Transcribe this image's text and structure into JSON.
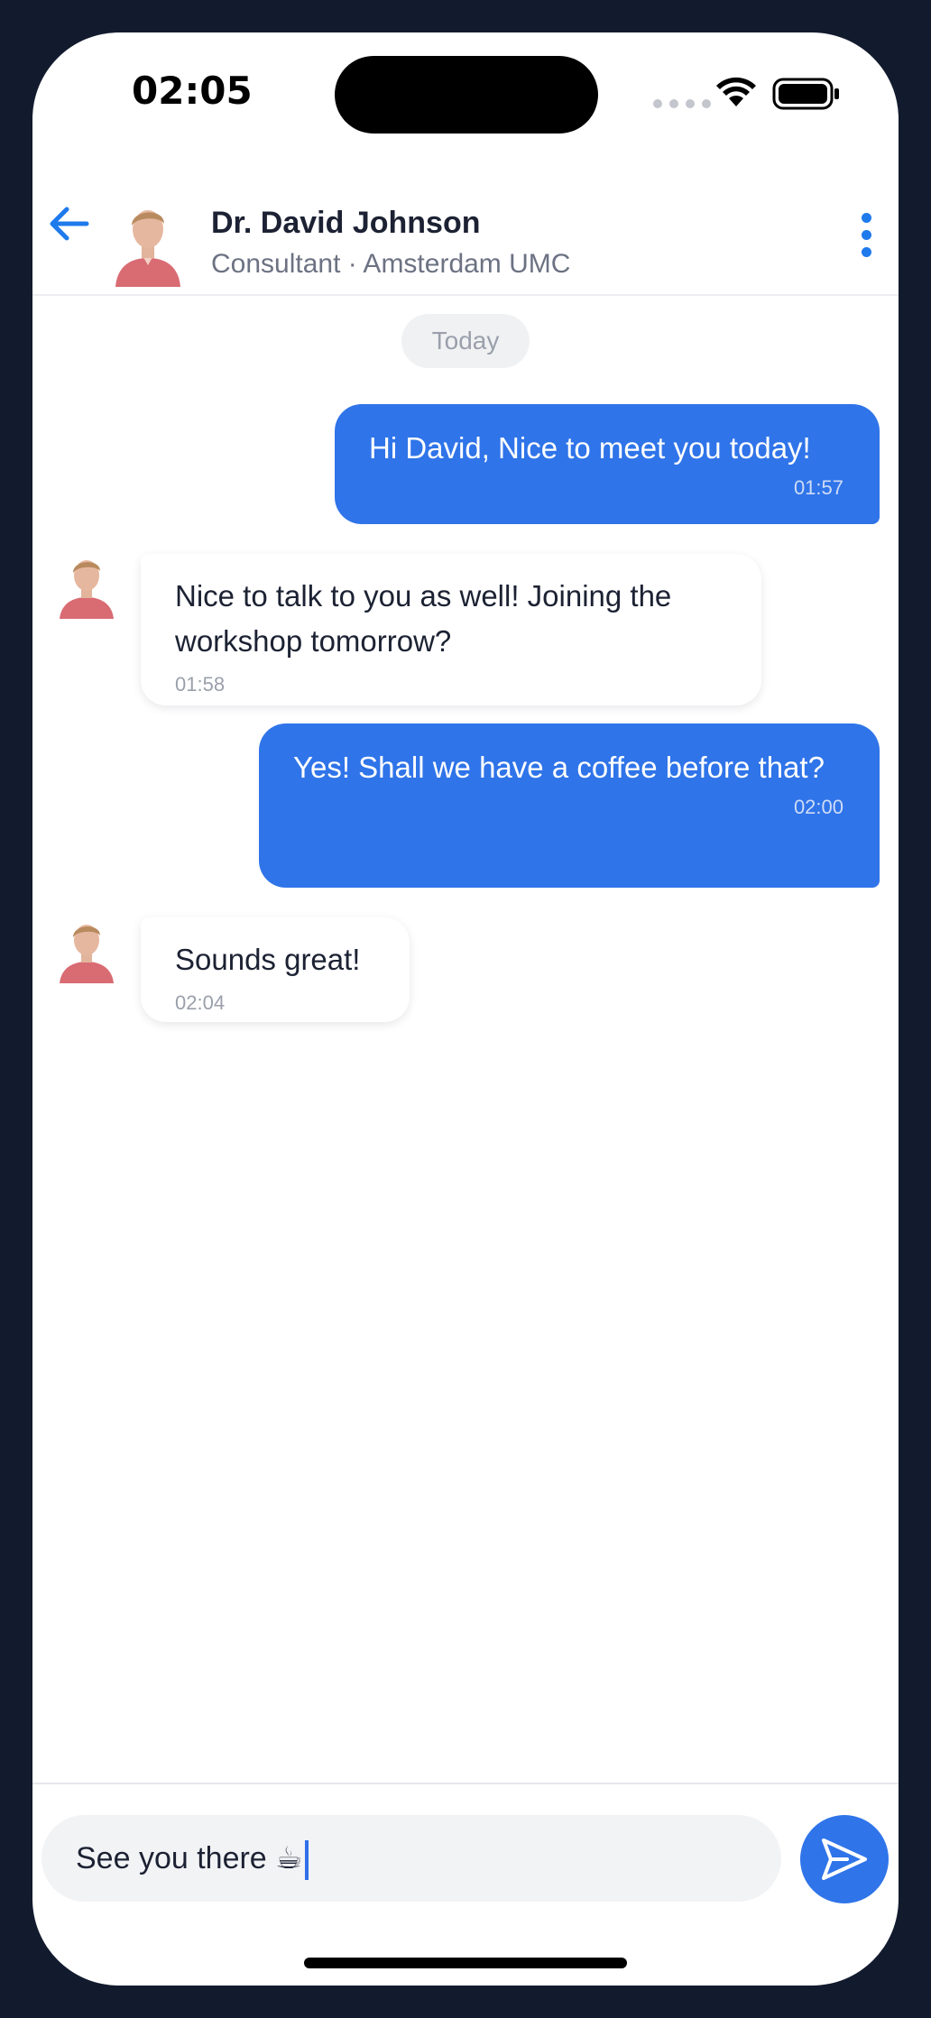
{
  "status_bar": {
    "time": "02:05"
  },
  "header": {
    "contact_name": "Dr. David Johnson",
    "contact_subtitle": "Consultant · Amsterdam UMC"
  },
  "chat": {
    "date_separator": "Today",
    "messages": [
      {
        "direction": "outgoing",
        "text": "Hi David, Nice to meet you today!",
        "time": "01:57"
      },
      {
        "direction": "incoming",
        "text": "Nice to talk to you as well! Joining the workshop tomorrow?",
        "time": "01:58"
      },
      {
        "direction": "outgoing",
        "text": "Yes! Shall we have a coffee before that?",
        "time": "02:00"
      },
      {
        "direction": "incoming",
        "text": "Sounds great!",
        "time": "02:04"
      }
    ]
  },
  "composer": {
    "value": "See you there ☕"
  },
  "colors": {
    "accent": "#2f74e9",
    "frame": "#121a2e",
    "bubble_in": "#ffffff",
    "chip": "#f0f1f3"
  }
}
